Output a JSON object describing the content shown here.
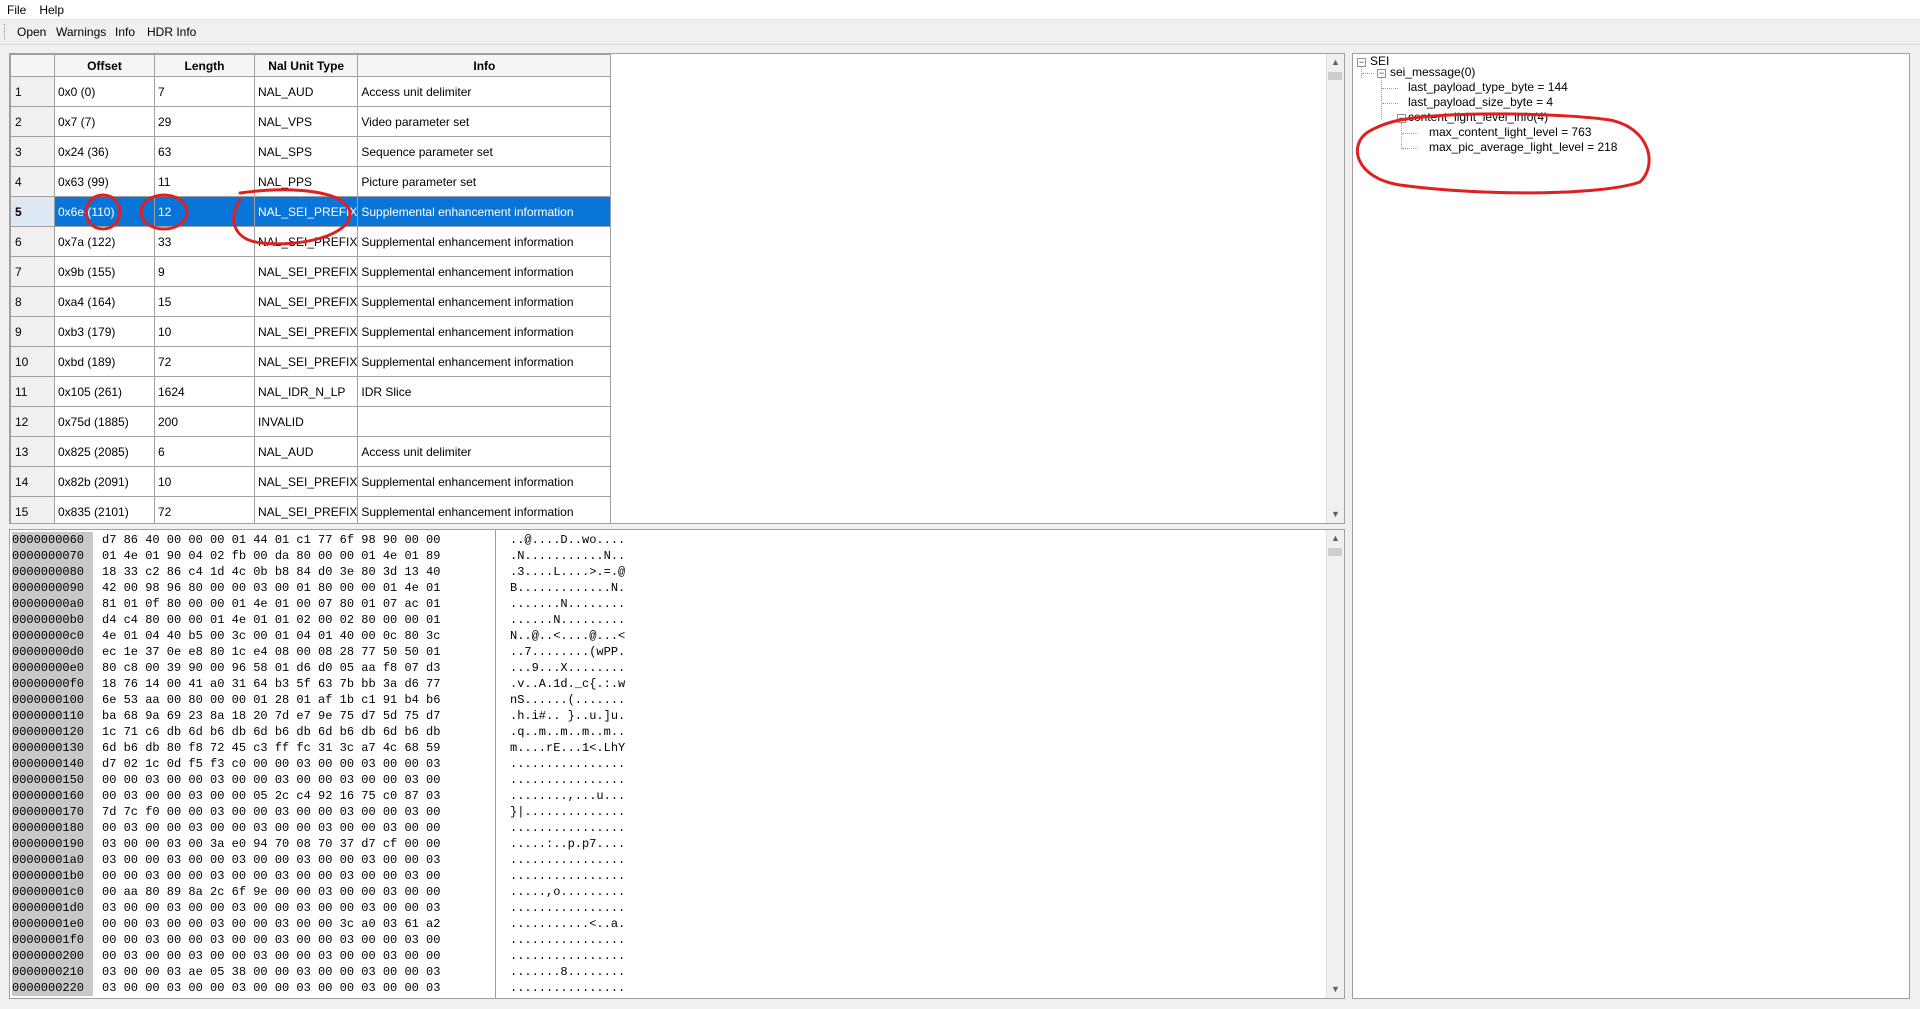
{
  "menu": [
    "File",
    "Help"
  ],
  "toolbar": [
    "Open",
    "Warnings",
    "Info",
    "HDR Info"
  ],
  "nal_table": {
    "headers": [
      "Offset",
      "Length",
      "Nal Unit Type",
      "Info"
    ],
    "selected_row": 5,
    "rows": [
      {
        "n": "1",
        "offset": "0x0 (0)",
        "length": "7",
        "type": "NAL_AUD",
        "info": "Access unit delimiter"
      },
      {
        "n": "2",
        "offset": "0x7 (7)",
        "length": "29",
        "type": "NAL_VPS",
        "info": "Video parameter set"
      },
      {
        "n": "3",
        "offset": "0x24 (36)",
        "length": "63",
        "type": "NAL_SPS",
        "info": "Sequence parameter set"
      },
      {
        "n": "4",
        "offset": "0x63 (99)",
        "length": "11",
        "type": "NAL_PPS",
        "info": "Picture parameter set"
      },
      {
        "n": "5",
        "offset": "0x6e (110)",
        "length": "12",
        "type": "NAL_SEI_PREFIX",
        "info": "Supplemental enhancement information"
      },
      {
        "n": "6",
        "offset": "0x7a (122)",
        "length": "33",
        "type": "NAL_SEI_PREFIX",
        "info": "Supplemental enhancement information"
      },
      {
        "n": "7",
        "offset": "0x9b (155)",
        "length": "9",
        "type": "NAL_SEI_PREFIX",
        "info": "Supplemental enhancement information"
      },
      {
        "n": "8",
        "offset": "0xa4 (164)",
        "length": "15",
        "type": "NAL_SEI_PREFIX",
        "info": "Supplemental enhancement information"
      },
      {
        "n": "9",
        "offset": "0xb3 (179)",
        "length": "10",
        "type": "NAL_SEI_PREFIX",
        "info": "Supplemental enhancement information"
      },
      {
        "n": "10",
        "offset": "0xbd (189)",
        "length": "72",
        "type": "NAL_SEI_PREFIX",
        "info": "Supplemental enhancement information"
      },
      {
        "n": "11",
        "offset": "0x105 (261)",
        "length": "1624",
        "type": "NAL_IDR_N_LP",
        "info": "IDR Slice"
      },
      {
        "n": "12",
        "offset": "0x75d (1885)",
        "length": "200",
        "type": "INVALID",
        "info": ""
      },
      {
        "n": "13",
        "offset": "0x825 (2085)",
        "length": "6",
        "type": "NAL_AUD",
        "info": "Access unit delimiter"
      },
      {
        "n": "14",
        "offset": "0x82b (2091)",
        "length": "10",
        "type": "NAL_SEI_PREFIX",
        "info": "Supplemental enhancement information"
      },
      {
        "n": "15",
        "offset": "0x835 (2101)",
        "length": "72",
        "type": "NAL_SEI_PREFIX",
        "info": "Supplemental enhancement information"
      }
    ]
  },
  "hex_rows": [
    {
      "off": "0000000060",
      "bytes": "d7 86 40 00 00 00 01 44 01 c1 77 6f 98 90 00 00",
      "ascii": "..@....D..wo...."
    },
    {
      "off": "0000000070",
      "bytes": "01 4e 01 90 04 02 fb 00 da 80 00 00 01 4e 01 89",
      "ascii": ".N...........N.."
    },
    {
      "off": "0000000080",
      "bytes": "18 33 c2 86 c4 1d 4c 0b b8 84 d0 3e 80 3d 13 40",
      "ascii": ".3....L....>.=.@"
    },
    {
      "off": "0000000090",
      "bytes": "42 00 98 96 80 00 00 03 00 01 80 00 00 01 4e 01",
      "ascii": "B.............N."
    },
    {
      "off": "00000000a0",
      "bytes": "81 01 0f 80 00 00 01 4e 01 00 07 80 01 07 ac 01",
      "ascii": ".......N........"
    },
    {
      "off": "00000000b0",
      "bytes": "d4 c4 80 00 00 01 4e 01 01 02 00 02 80 00 00 01",
      "ascii": "......N........."
    },
    {
      "off": "00000000c0",
      "bytes": "4e 01 04 40 b5 00 3c 00 01 04 01 40 00 0c 80 3c",
      "ascii": "N..@..<....@...<"
    },
    {
      "off": "00000000d0",
      "bytes": "ec 1e 37 0e e8 80 1c e4 08 00 08 28 77 50 50 01",
      "ascii": "..7........(wPP."
    },
    {
      "off": "00000000e0",
      "bytes": "80 c8 00 39 90 00 96 58 01 d6 d0 05 aa f8 07 d3",
      "ascii": "...9...X........"
    },
    {
      "off": "00000000f0",
      "bytes": "18 76 14 00 41 a0 31 64 b3 5f 63 7b bb 3a d6 77",
      "ascii": ".v..A.1d._c{.:.w"
    },
    {
      "off": "0000000100",
      "bytes": "6e 53 aa 00 80 00 00 01 28 01 af 1b c1 91 b4 b6",
      "ascii": "nS......(......."
    },
    {
      "off": "0000000110",
      "bytes": "ba 68 9a 69 23 8a 18 20 7d e7 9e 75 d7 5d 75 d7",
      "ascii": ".h.i#.. }..u.]u."
    },
    {
      "off": "0000000120",
      "bytes": "1c 71 c6 db 6d b6 db 6d b6 db 6d b6 db 6d b6 db",
      "ascii": ".q..m..m..m..m.."
    },
    {
      "off": "0000000130",
      "bytes": "6d b6 db 80 f8 72 45 c3 ff fc 31 3c a7 4c 68 59",
      "ascii": "m....rE...1<.LhY"
    },
    {
      "off": "0000000140",
      "bytes": "d7 02 1c 0d f5 f3 c0 00 00 03 00 00 03 00 00 03",
      "ascii": "................"
    },
    {
      "off": "0000000150",
      "bytes": "00 00 03 00 00 03 00 00 03 00 00 03 00 00 03 00",
      "ascii": "................"
    },
    {
      "off": "0000000160",
      "bytes": "00 03 00 00 03 00 00 05 2c c4 92 16 75 c0 87 03",
      "ascii": "........,...u..."
    },
    {
      "off": "0000000170",
      "bytes": "7d 7c f0 00 00 03 00 00 03 00 00 03 00 00 03 00",
      "ascii": "}|.............."
    },
    {
      "off": "0000000180",
      "bytes": "00 03 00 00 03 00 00 03 00 00 03 00 00 03 00 00",
      "ascii": "................"
    },
    {
      "off": "0000000190",
      "bytes": "03 00 00 03 00 3a e0 94 70 08 70 37 d7 cf 00 00",
      "ascii": ".....:..p.p7...."
    },
    {
      "off": "00000001a0",
      "bytes": "03 00 00 03 00 00 03 00 00 03 00 00 03 00 00 03",
      "ascii": "................"
    },
    {
      "off": "00000001b0",
      "bytes": "00 00 03 00 00 03 00 00 03 00 00 03 00 00 03 00",
      "ascii": "................"
    },
    {
      "off": "00000001c0",
      "bytes": "00 aa 80 89 8a 2c 6f 9e 00 00 03 00 00 03 00 00",
      "ascii": ".....,o........."
    },
    {
      "off": "00000001d0",
      "bytes": "03 00 00 03 00 00 03 00 00 03 00 00 03 00 00 03",
      "ascii": "................"
    },
    {
      "off": "00000001e0",
      "bytes": "00 00 03 00 00 03 00 00 03 00 00 3c a0 03 61 a2",
      "ascii": "...........<..a."
    },
    {
      "off": "00000001f0",
      "bytes": "00 00 03 00 00 03 00 00 03 00 00 03 00 00 03 00",
      "ascii": "................"
    },
    {
      "off": "0000000200",
      "bytes": "00 03 00 00 03 00 00 03 00 00 03 00 00 03 00 00",
      "ascii": "................"
    },
    {
      "off": "0000000210",
      "bytes": "03 00 00 03 ae 05 38 00 00 03 00 00 03 00 00 03",
      "ascii": ".......8........"
    },
    {
      "off": "0000000220",
      "bytes": "03 00 00 03 00 00 03 00 00 03 00 00 03 00 00 03",
      "ascii": "................"
    }
  ],
  "tree": {
    "root": "SEI",
    "message": "sei_message(0)",
    "payload_type": "last_payload_type_byte = 144",
    "payload_size": "last_payload_size_byte = 4",
    "cll_info": "content_light_level_info(4)",
    "max_cll": "max_content_light_level = 763",
    "max_fall": "max_pic_average_light_level = 218"
  },
  "colors": {
    "selection": "#0a75d8",
    "annotation": "#e02020",
    "offset_bg": "#c8c8c8"
  }
}
